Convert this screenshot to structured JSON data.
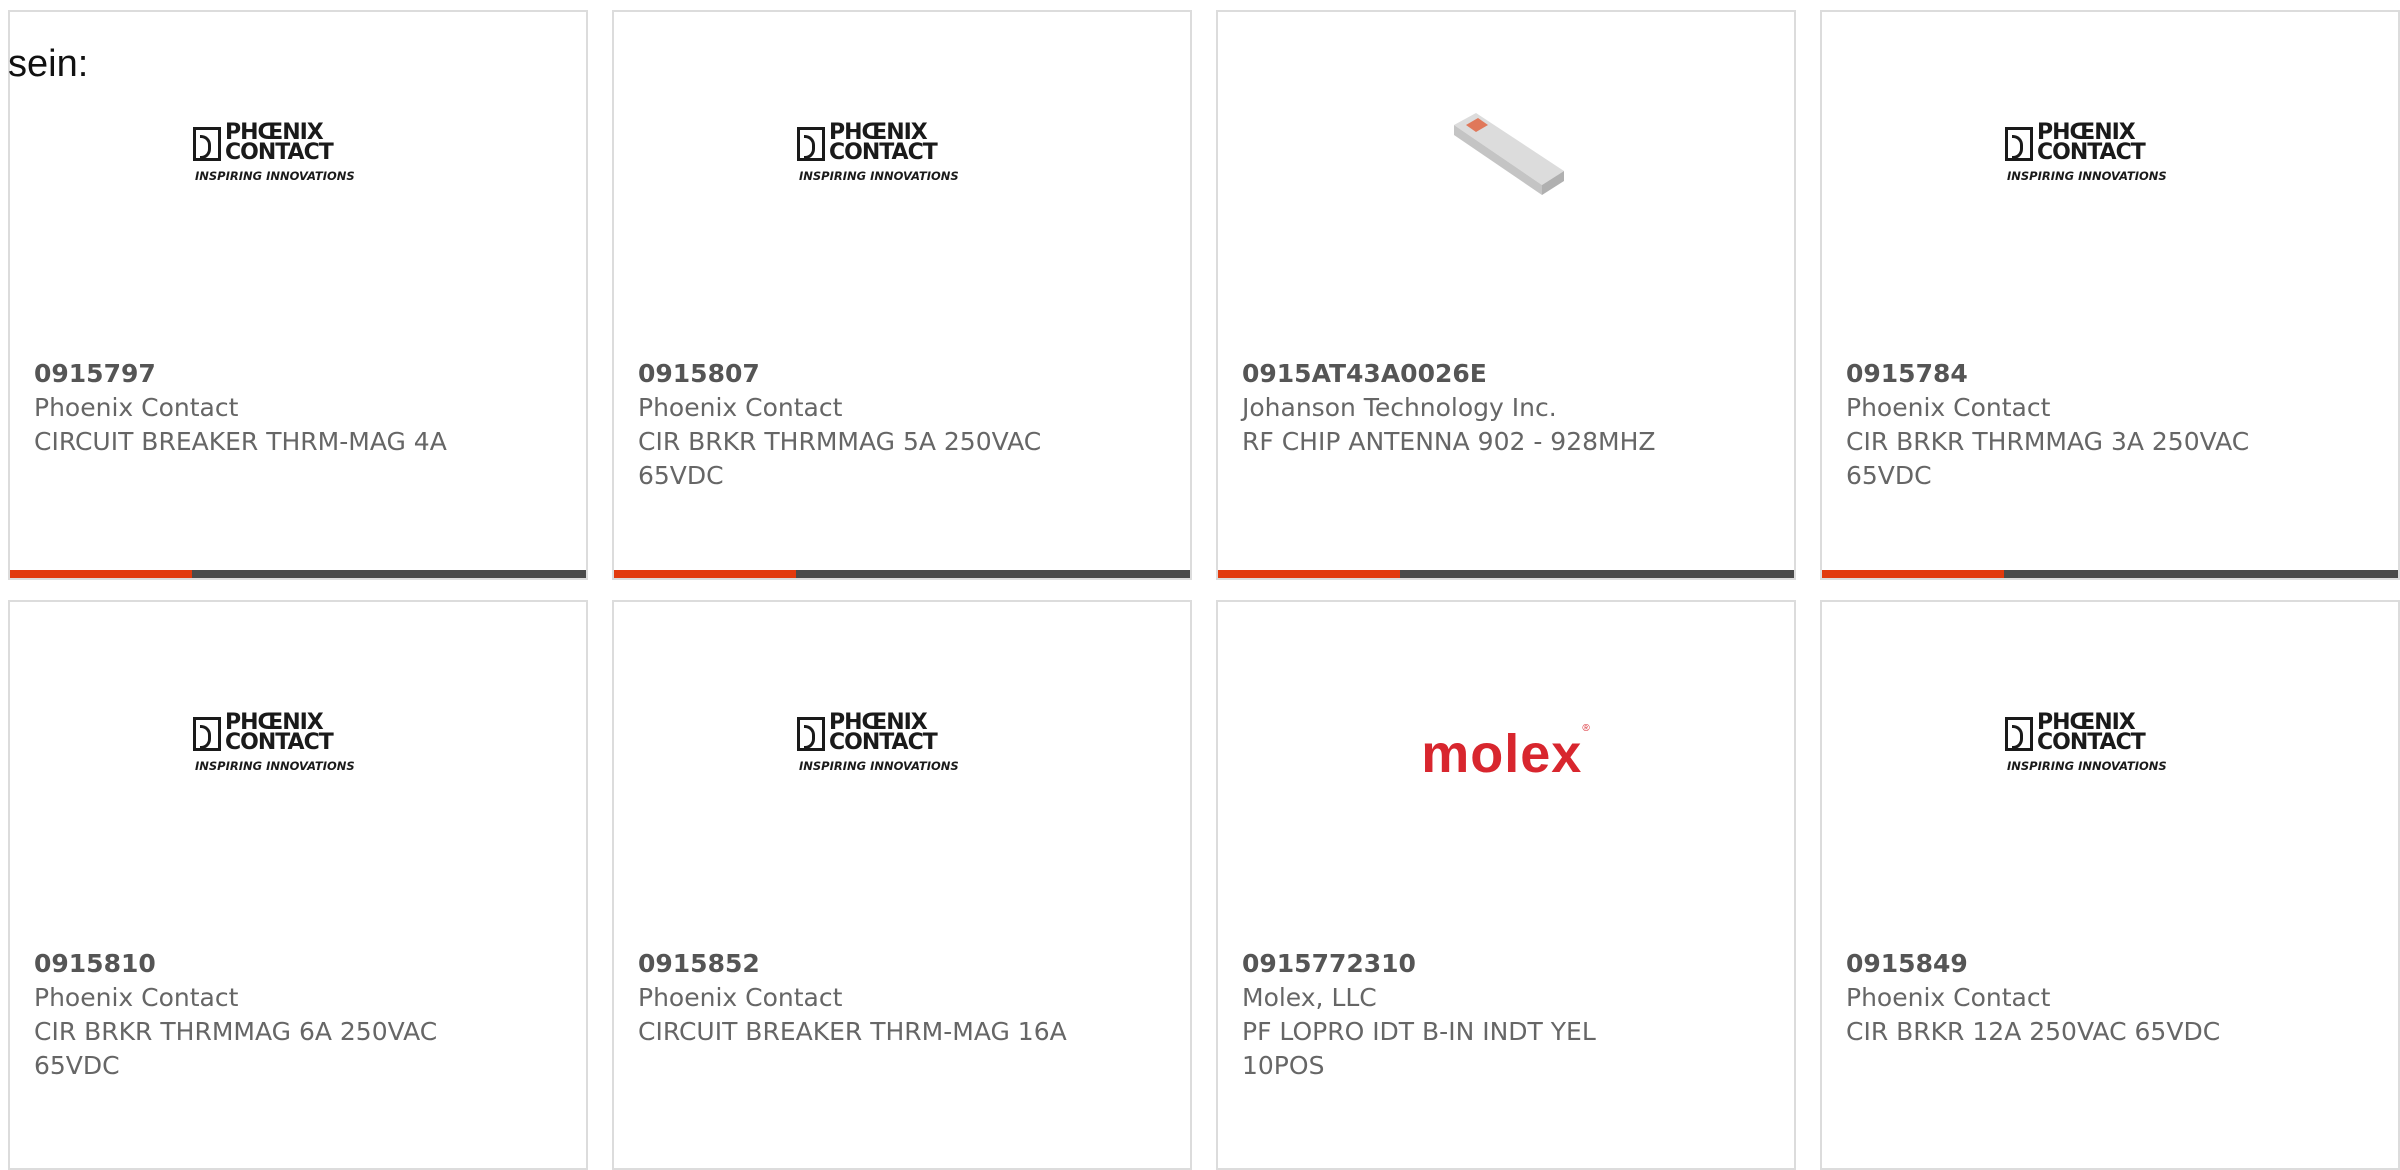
{
  "page": {
    "heading": "sein:"
  },
  "colors": {
    "accent": "#e23a0e",
    "bar": "#4a4a4a",
    "molex": "#d8262e"
  },
  "products": [
    {
      "part_number": "0915797",
      "manufacturer": "Phoenix Contact",
      "description": "CIRCUIT BREAKER THRM-MAG 4A",
      "image": "phoenix-contact-logo",
      "logo_line1": "PHŒNIX",
      "logo_line2": "CONTACT",
      "logo_tagline": "INSPIRING INNOVATIONS"
    },
    {
      "part_number": "0915807",
      "manufacturer": "Phoenix Contact",
      "description": "CIR BRKR THRMMAG 5A 250VAC 65VDC",
      "image": "phoenix-contact-logo",
      "logo_line1": "PHŒNIX",
      "logo_line2": "CONTACT",
      "logo_tagline": "INSPIRING INNOVATIONS"
    },
    {
      "part_number": "0915AT43A0026E",
      "manufacturer": "Johanson Technology Inc.",
      "description": "RF CHIP ANTENNA 902 - 928MHZ",
      "image": "chip-antenna-photo"
    },
    {
      "part_number": "0915784",
      "manufacturer": "Phoenix Contact",
      "description": "CIR BRKR THRMMAG 3A 250VAC 65VDC",
      "image": "phoenix-contact-logo",
      "logo_line1": "PHŒNIX",
      "logo_line2": "CONTACT",
      "logo_tagline": "INSPIRING INNOVATIONS"
    },
    {
      "part_number": "0915810",
      "manufacturer": "Phoenix Contact",
      "description": "CIR BRKR THRMMAG 6A 250VAC 65VDC",
      "image": "phoenix-contact-logo",
      "logo_line1": "PHŒNIX",
      "logo_line2": "CONTACT",
      "logo_tagline": "INSPIRING INNOVATIONS"
    },
    {
      "part_number": "0915852",
      "manufacturer": "Phoenix Contact",
      "description": "CIRCUIT BREAKER THRM-MAG 16A",
      "image": "phoenix-contact-logo",
      "logo_line1": "PHŒNIX",
      "logo_line2": "CONTACT",
      "logo_tagline": "INSPIRING INNOVATIONS"
    },
    {
      "part_number": "0915772310",
      "manufacturer": "Molex, LLC",
      "description": "PF LOPRO IDT B-IN INDT YEL 10POS",
      "image": "molex-logo",
      "logo_text": "molex"
    },
    {
      "part_number": "0915849",
      "manufacturer": "Phoenix Contact",
      "description": "CIR BRKR 12A 250VAC 65VDC",
      "image": "phoenix-contact-logo",
      "logo_line1": "PHŒNIX",
      "logo_line2": "CONTACT",
      "logo_tagline": "INSPIRING INNOVATIONS"
    }
  ]
}
